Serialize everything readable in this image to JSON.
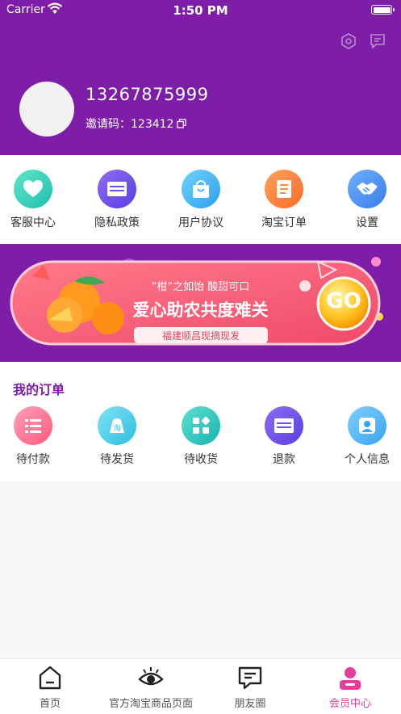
{
  "status_bar": {
    "carrier": "Carrier",
    "time": "1:50 PM"
  },
  "profile": {
    "phone": "13267875999",
    "invite_label": "邀请码：123412"
  },
  "menu": [
    {
      "label": "客服中心",
      "icon": "heart-chat-icon",
      "color": "#3fd3b8"
    },
    {
      "label": "隐私政策",
      "icon": "card-icon",
      "color": "#6a52e8"
    },
    {
      "label": "用户协议",
      "icon": "shopping-bag-icon",
      "color": "#4ab3f5"
    },
    {
      "label": "淘宝订单",
      "icon": "document-icon",
      "color": "#ff8a3d"
    },
    {
      "label": "设置",
      "icon": "handshake-icon",
      "color": "#4a8ff0"
    }
  ],
  "banner": {
    "line1": "“柑”之如饴  酸甜可口",
    "line2": "爱心助农共度难关",
    "line3": "福建顺昌现摘现发",
    "go": "GO"
  },
  "orders": {
    "title": "我的订单",
    "items": [
      {
        "label": "待付款",
        "icon": "list-icon",
        "color": "#ff6f91"
      },
      {
        "label": "待发货",
        "icon": "taobao-bag-icon",
        "color": "#40c9e0"
      },
      {
        "label": "待收货",
        "icon": "grid-icon",
        "color": "#2ec7b5"
      },
      {
        "label": "退款",
        "icon": "card-icon",
        "color": "#6a52e8"
      },
      {
        "label": "个人信息",
        "icon": "person-icon",
        "color": "#4ab3f5"
      }
    ]
  },
  "tabs": [
    {
      "label": "首页",
      "icon": "home-icon"
    },
    {
      "label": "官方淘宝商品页面",
      "icon": "eye-icon"
    },
    {
      "label": "朋友圈",
      "icon": "message-icon"
    },
    {
      "label": "会员中心",
      "icon": "member-icon"
    }
  ],
  "colors": {
    "header": "#7e1ea8",
    "active_tab": "#e63c9a"
  }
}
